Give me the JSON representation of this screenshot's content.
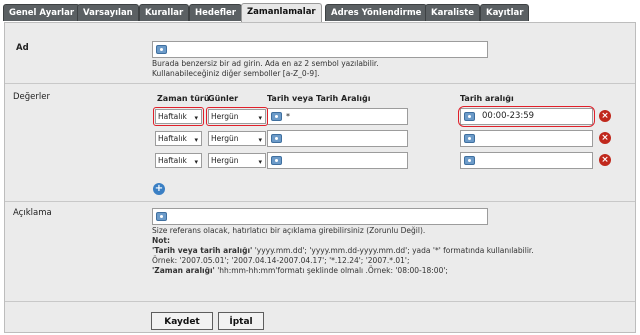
{
  "tabs": [
    {
      "label": "Genel Ayarlar",
      "active": false
    },
    {
      "label": "Varsayılan",
      "active": false
    },
    {
      "label": "Kurallar",
      "active": false
    },
    {
      "label": "Hedefler",
      "active": false
    },
    {
      "label": "Zamanlamalar",
      "active": true
    },
    {
      "label": "Adres Yönlendirme",
      "active": false
    },
    {
      "label": "Karaliste",
      "active": false
    },
    {
      "label": "Kayıtlar",
      "active": false
    }
  ],
  "name_section": {
    "label": "Ad",
    "value": "",
    "hint_line1": "Burada benzersiz bir ad girin. Ada en az 2 sembol yazılabilir.",
    "hint_line2": "Kullanabileceğiniz diğer semboller [a-Z_0-9]."
  },
  "values_section": {
    "label": "Değerler",
    "col_time_type": "Zaman türü",
    "col_days": "Günler",
    "col_date": "Tarih veya Tarih Aralığı",
    "col_time_range": "Tarih aralığı",
    "rows": [
      {
        "time_type": "Haftalık",
        "days": "Hergün",
        "date": "*",
        "time_range": "00:00-23:59"
      },
      {
        "time_type": "Haftalık",
        "days": "Hergün",
        "date": "",
        "time_range": ""
      },
      {
        "time_type": "Haftalık",
        "days": "Hergün",
        "date": "",
        "time_range": ""
      }
    ]
  },
  "description_section": {
    "label": "Açıklama",
    "value": "",
    "hint_line1": "Size referans olacak, hatırlatıcı bir açıklama girebilirsiniz (Zorunlu Değil).",
    "note_label": "Not:",
    "note_date_label": "'Tarih veya tarih aralığı'",
    "note_date_text": " 'yyyy.mm.dd'; 'yyyy.mm.dd-yyyy.mm.dd'; yada '*' formatında kullanılabilir.",
    "note_example1": "Örnek: '2007.05.01'; '2007.04.14-2007.04.17'; '*.12.24'; '2007.*.01';",
    "note_time_label": "'Zaman aralığı'",
    "note_time_text": " 'hh:mm-hh:mm'formatı şeklinde olmalı .Örnek: '08:00-18:00';"
  },
  "buttons": {
    "save": "Kaydet",
    "cancel": "İptal"
  }
}
